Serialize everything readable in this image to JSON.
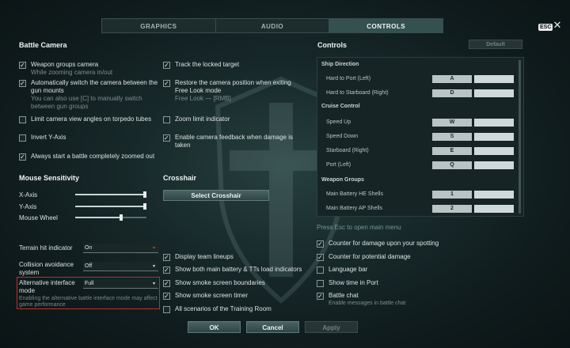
{
  "tabs": [
    {
      "label": "GRAPHICS",
      "active": false
    },
    {
      "label": "AUDIO",
      "active": false
    },
    {
      "label": "CONTROLS",
      "active": true
    }
  ],
  "esc_badge": "ESC",
  "battle_camera": {
    "title": "Battle Camera",
    "left": [
      {
        "label": "Weapon groups camera",
        "sub": "While zooming camera in/out",
        "checked": true
      },
      {
        "label": "Automatically switch the camera between the gun mounts",
        "sub": "You can also use [C] to manually switch between gun groups",
        "checked": true
      },
      {
        "label": "Limit camera view angles on torpedo tubes",
        "sub": "",
        "checked": false
      },
      {
        "label": "Invert Y-Axis",
        "sub": "",
        "checked": false
      },
      {
        "label": "Always start a battle completely zoomed out",
        "sub": "",
        "checked": true
      }
    ],
    "right": [
      {
        "label": "Track the locked target",
        "sub": "",
        "checked": true
      },
      {
        "label": "Restore the camera position when exiting Free Look mode",
        "sub": "Free Look — [RMB]",
        "checked": true
      },
      {
        "label": "Zoom limit indicator",
        "sub": "",
        "checked": false
      },
      {
        "label": "Enable camera feedback when damage is taken",
        "sub": "",
        "checked": true
      }
    ]
  },
  "mouse_sensitivity": {
    "title": "Mouse Sensitivity",
    "sliders": [
      {
        "label": "X-Axis",
        "value": 0.98
      },
      {
        "label": "Y-Axis",
        "value": 0.98
      },
      {
        "label": "Mouse Wheel",
        "value": 0.64
      }
    ]
  },
  "crosshair": {
    "title": "Crosshair",
    "button": "Select Crosshair"
  },
  "dropdowns": [
    {
      "label": "Terrain hit indicator",
      "value": "On",
      "caret": "▾"
    },
    {
      "label": "Collision avoidance system",
      "value": "Off",
      "caret": "▾"
    },
    {
      "label": "Alternative interface mode",
      "value": "Full",
      "caret": "▾",
      "sub": "Enabling the alternative battle interface mode may affect game performance"
    }
  ],
  "interface_checks": [
    {
      "label": "Display team lineups",
      "checked": true
    },
    {
      "label": "Show both main battery & TTs load indicators",
      "checked": true
    },
    {
      "label": "Show smoke screen boundaries",
      "checked": true
    },
    {
      "label": "Show smoke screen timer",
      "checked": true
    },
    {
      "label": "All scenarios of the Training Room",
      "checked": false
    }
  ],
  "controls": {
    "title": "Controls",
    "default_button": "Default",
    "groups": [
      {
        "group": "Ship Direction",
        "items": [
          {
            "label": "Hard to Port (Left)",
            "key": "A"
          },
          {
            "label": "Hard to Starboard (Right)",
            "key": "D"
          }
        ]
      },
      {
        "group": "Cruise Control",
        "items": [
          {
            "label": "Speed Up",
            "key": "W"
          },
          {
            "label": "Speed Down",
            "key": "S"
          },
          {
            "label": "Starboard (Right)",
            "key": "E"
          },
          {
            "label": "Port (Left)",
            "key": "Q"
          }
        ]
      },
      {
        "group": "Weapon Groups",
        "items": [
          {
            "label": "Main Battery HE Shells",
            "key": "1"
          },
          {
            "label": "Main Battery AP Shells",
            "key": "2"
          }
        ]
      }
    ],
    "hint": "Press Esc to open main menu"
  },
  "right_checks": [
    {
      "label": "Counter for damage upon your spotting",
      "sub": "",
      "checked": true
    },
    {
      "label": "Counter for potential damage",
      "sub": "",
      "checked": true
    },
    {
      "label": "Language bar",
      "sub": "",
      "checked": false
    },
    {
      "label": "Show time in Port",
      "sub": "",
      "checked": false
    },
    {
      "label": "Battle chat",
      "sub": "Enable messages in battle chat",
      "checked": true
    }
  ],
  "footer": {
    "ok": "OK",
    "cancel": "Cancel",
    "apply": "Apply"
  }
}
